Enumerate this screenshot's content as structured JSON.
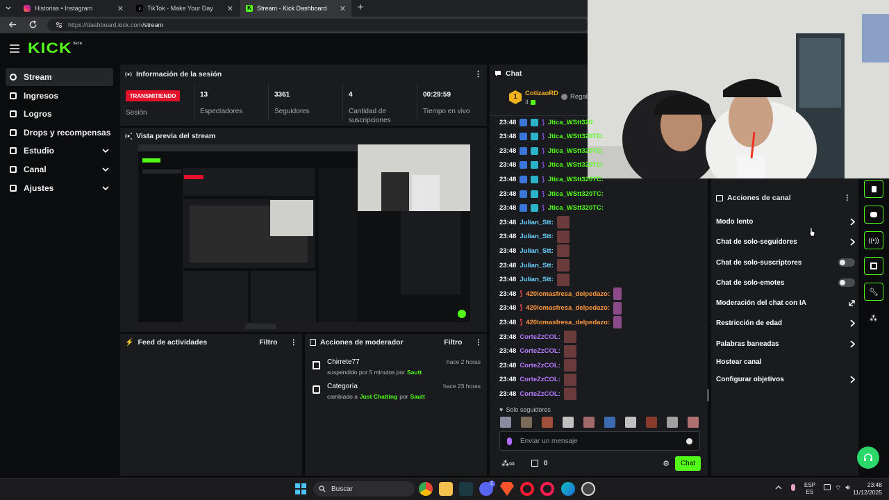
{
  "browser": {
    "tabs": [
      {
        "title": "Historias • Instagram"
      },
      {
        "title": "TikTok - Make Your Day"
      },
      {
        "title": "Stream - Kick Dashboard"
      }
    ],
    "url": "https://dashboard.kick.com/stream",
    "url_host": "https://dashboard.kick.com",
    "url_path": "/stream"
  },
  "site": {
    "logo": "KICK",
    "logo_badge": "BETA",
    "sidebar": [
      {
        "label": "Stream",
        "icon": "broadcast-icon"
      },
      {
        "label": "Ingresos",
        "icon": "wallet-icon"
      },
      {
        "label": "Logros",
        "icon": "trophy-icon"
      },
      {
        "label": "Drops y recompensas",
        "icon": "gift-icon"
      },
      {
        "label": "Estudio",
        "icon": "studio-icon"
      },
      {
        "label": "Canal",
        "icon": "channel-icon"
      },
      {
        "label": "Ajustes",
        "icon": "gear-icon"
      }
    ],
    "session": {
      "title": "Información de la sesión",
      "status": "TRANSMITIENDO",
      "status_label": "Sesión",
      "stats": [
        {
          "value": "13",
          "label": "Espectadores"
        },
        {
          "value": "3361",
          "label": "Seguidores"
        },
        {
          "value": "4",
          "label": "Cantidad de suscripciones"
        },
        {
          "value": "00:29:59",
          "label": "Tiempo en vivo"
        }
      ]
    },
    "preview": {
      "title": "Vista previa del stream"
    },
    "activity": {
      "title": "Feed de actividades",
      "filter": "Filtro"
    },
    "modactions": {
      "title": "Acciones de moderador",
      "filter": "Filtro",
      "items": [
        {
          "user": "Chirrete77",
          "pre": "suspendido por 5 minutos por",
          "mod": "Sautt",
          "time": "hace 2 horas",
          "icon": "hourglass-icon"
        },
        {
          "user": "Categoría",
          "pre": "cambiado a",
          "target": "Just Chatting",
          "mid": "por",
          "mod": "Sautt",
          "time": "hace 23 horas",
          "icon": "category-icon"
        }
      ]
    },
    "chat": {
      "title": "Chat",
      "top_user": "CotizaoRD",
      "top_rank": "1",
      "top_count": "4",
      "gift_label": "Regala",
      "messages": [
        {
          "time": "23:48",
          "user": "Jtica_WStt320",
          "color": "#53fc18"
        },
        {
          "time": "23:48",
          "user": "Jtica_WStt320TC:",
          "color": "#53fc18"
        },
        {
          "time": "23:48",
          "user": "Jtica_WStt320TC:",
          "color": "#53fc18"
        },
        {
          "time": "23:48",
          "user": "Jtica_WStt320TC:",
          "color": "#53fc18"
        },
        {
          "time": "23:48",
          "user": "Jtica_WStt320TC:",
          "color": "#53fc18"
        },
        {
          "time": "23:48",
          "user": "Jtica_WStt320TC:",
          "color": "#53fc18"
        },
        {
          "time": "23:48",
          "user": "Jtica_WStt320TC:",
          "color": "#53fc18"
        },
        {
          "time": "23:48",
          "user": "Julian_Stt:",
          "color": "#6ad2ff"
        },
        {
          "time": "23:48",
          "user": "Julian_Stt:",
          "color": "#6ad2ff"
        },
        {
          "time": "23:48",
          "user": "Julian_Stt:",
          "color": "#6ad2ff"
        },
        {
          "time": "23:48",
          "user": "Julian_Stt:",
          "color": "#6ad2ff"
        },
        {
          "time": "23:48",
          "user": "Julian_Stt:",
          "color": "#6ad2ff"
        },
        {
          "time": "23:48",
          "user": "420lomasfresa_delpedazo:",
          "color": "#ff9a3c"
        },
        {
          "time": "23:48",
          "user": "420lomasfresa_delpedazo:",
          "color": "#ff9a3c"
        },
        {
          "time": "23:48",
          "user": "420lomasfresa_delpedazo:",
          "color": "#ff9a3c"
        },
        {
          "time": "23:48",
          "user": "CorteZzCOL:",
          "color": "#b77cff"
        },
        {
          "time": "23:48",
          "user": "CorteZzCOL:",
          "color": "#b77cff"
        },
        {
          "time": "23:48",
          "user": "CorteZzCOL:",
          "color": "#b77cff"
        },
        {
          "time": "23:48",
          "user": "CorteZzCOL:",
          "color": "#b77cff"
        },
        {
          "time": "23:48",
          "user": "CorteZzCOL:",
          "color": "#b77cff"
        }
      ],
      "followers_only": "Solo seguidores",
      "input_placeholder": "Enviar un mensaje",
      "points": "0",
      "send": "Chat"
    },
    "channel_actions": {
      "title": "Acciones de canal",
      "items": [
        {
          "label": "Modo lento",
          "control": "chevron"
        },
        {
          "label": "Chat de solo-seguidores",
          "control": "chevron"
        },
        {
          "label": "Chat de solo-suscriptores",
          "control": "toggle"
        },
        {
          "label": "Chat de solo-emotes",
          "control": "toggle"
        },
        {
          "label": "Moderación del chat con IA",
          "control": "external"
        },
        {
          "label": "Restricción de edad",
          "control": "chevron"
        },
        {
          "label": "Palabras baneadas",
          "control": "chevron"
        },
        {
          "label": "Hostear canal",
          "control": "none"
        },
        {
          "label": "Configurar objetivos",
          "control": "chevron"
        }
      ]
    }
  },
  "taskbar": {
    "search": "Buscar",
    "lang_top": "ESP",
    "lang_bottom": "ES",
    "time": "23:48",
    "date": "11/12/2025",
    "discord_badge": "2"
  },
  "colors": {
    "accent": "#53fc18",
    "live": "#e5112a",
    "panel": "#191b1f",
    "bg": "#0b0c0d"
  }
}
